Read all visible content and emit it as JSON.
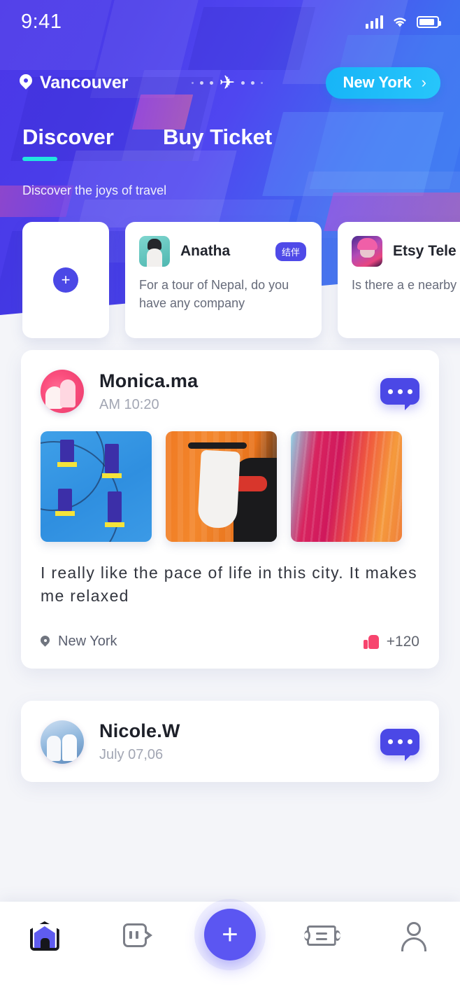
{
  "status_bar": {
    "time": "9:41",
    "signal_icon": "signal-bars-icon",
    "wifi_icon": "wifi-icon",
    "battery_icon": "battery-icon"
  },
  "header": {
    "origin": "Vancouver",
    "origin_icon": "location-pin-icon",
    "plane_icon": "airplane-icon",
    "destination": "New York",
    "destination_chevron": "›",
    "tabs": [
      {
        "label": "Discover",
        "active": true
      },
      {
        "label": "Buy Ticket",
        "active": false
      }
    ],
    "tagline": "Discover the joys of travel",
    "accent_color": "#21e6e0",
    "pill_color": "#1fbefa",
    "bg_gradient_from": "#4b37e8",
    "bg_gradient_to": "#3a7bf2"
  },
  "stories": {
    "add_button_label": "+",
    "items": [
      {
        "name": "Anatha",
        "badge": "结伴",
        "text": "For a tour of Nepal, do you have any company",
        "avatar": "anatha-avatar"
      },
      {
        "name": "Etsy Tele",
        "badge": "",
        "text": "Is there a e nearby",
        "avatar": "etsy-avatar"
      }
    ]
  },
  "feed": {
    "posts": [
      {
        "author": "Monica.ma",
        "time": "AM 10:20",
        "avatar": "monica-avatar",
        "comment_icon": "comment-bubble-icon",
        "images": [
          "blue-wall-windows",
          "orange-scooter",
          "abstract-paint"
        ],
        "text": "I really like the pace of life in this city. It makes me relaxed",
        "location": "New York",
        "location_icon": "location-pin-icon",
        "like_icon": "thumbs-up-icon",
        "likes": "+120",
        "like_color": "#f7456e"
      },
      {
        "author": "Nicole.W",
        "time": "July 07,06",
        "avatar": "nicole-avatar",
        "comment_icon": "comment-bubble-icon"
      }
    ]
  },
  "bottom_nav": {
    "items": [
      {
        "icon": "home-icon",
        "active": true
      },
      {
        "icon": "quote-message-icon",
        "active": false
      },
      {
        "icon": "ticket-icon",
        "active": false
      },
      {
        "icon": "person-icon",
        "active": false
      }
    ],
    "fab_label": "+",
    "fab_icon": "plus-icon",
    "fab_color": "#5b56f2"
  }
}
